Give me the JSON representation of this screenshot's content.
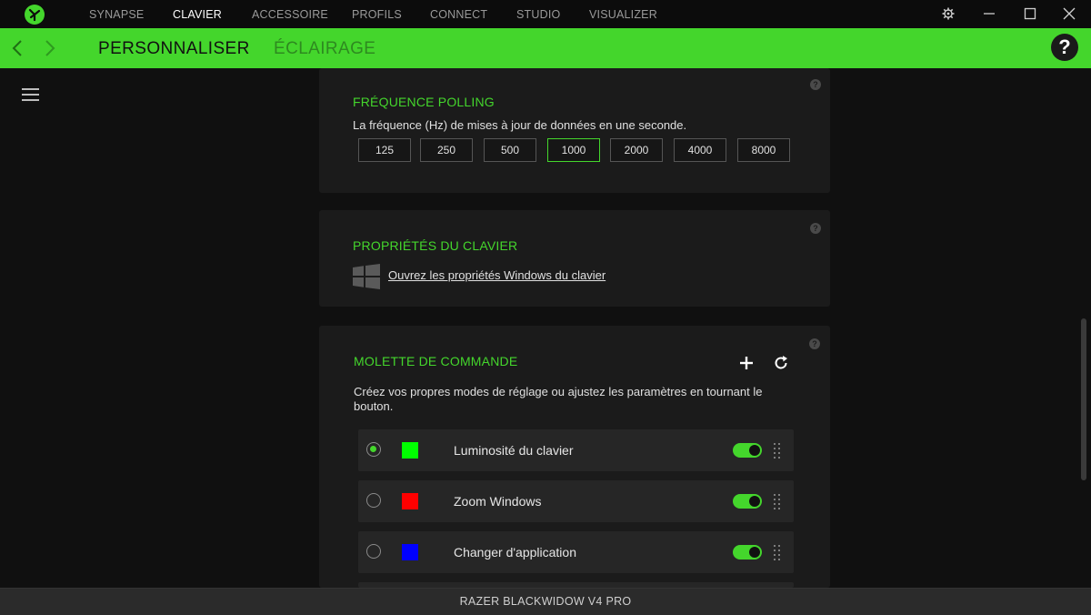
{
  "topnav": {
    "items": [
      "SYNAPSE",
      "CLAVIER",
      "ACCESSOIRE",
      "PROFILS",
      "CONNECT",
      "STUDIO",
      "VISUALIZER"
    ],
    "active": "CLAVIER"
  },
  "header": {
    "tabs": [
      "PERSONNALISER",
      "ÉCLAIRAGE"
    ],
    "active_tab": "PERSONNALISER",
    "help_label": "?"
  },
  "polling": {
    "title": "FRÉQUENCE POLLING",
    "description": "La fréquence (Hz) de mises à jour de données en une seconde.",
    "options": [
      "125",
      "250",
      "500",
      "1000",
      "2000",
      "4000",
      "8000"
    ],
    "selected": "1000"
  },
  "keyboard_props": {
    "title": "PROPRIÉTÉS DU CLAVIER",
    "link_text": "Ouvrez les propriétés Windows du clavier"
  },
  "dial": {
    "title": "MOLETTE DE COMMANDE",
    "description": "Créez vos propres modes de réglage ou ajustez les paramètres en tournant le bouton.",
    "modes": [
      {
        "label": "Luminosité du clavier",
        "color": "#00ff00",
        "selected": true,
        "enabled": true
      },
      {
        "label": "Zoom Windows",
        "color": "#ff0000",
        "selected": false,
        "enabled": true
      },
      {
        "label": "Changer d'application",
        "color": "#0000ff",
        "selected": false,
        "enabled": true
      }
    ]
  },
  "help_marker": "?",
  "footer": {
    "device_name": "RAZER BLACKWIDOW V4 PRO"
  },
  "colors": {
    "accent": "#44d62c",
    "background": "#101010",
    "panel": "#1b1b1b"
  }
}
